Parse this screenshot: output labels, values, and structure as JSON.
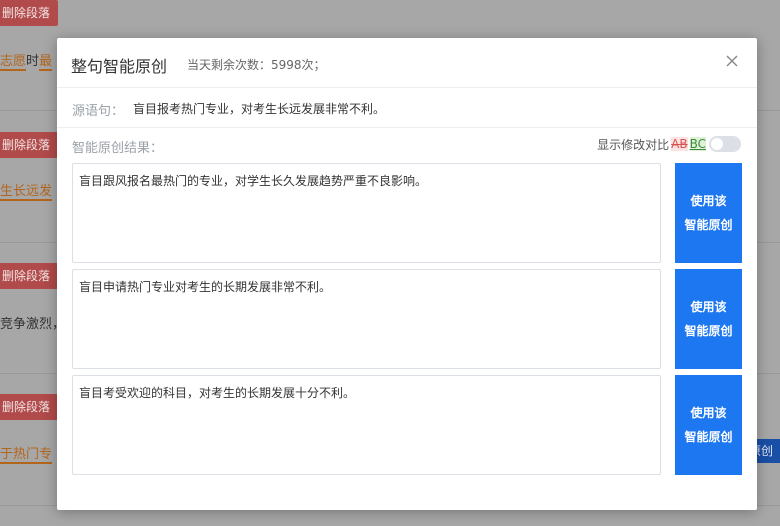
{
  "background": {
    "delete_label": "删除段落",
    "para1": {
      "hl1": "志愿",
      "mid": "时",
      "hl2": "最"
    },
    "para2": {
      "hl": "生长远发"
    },
    "para3": {
      "text": "竞争激烈，"
    },
    "para4": {
      "hl": "于热门专"
    },
    "right_button": "原创"
  },
  "modal": {
    "title": "整句智能原创",
    "remaining": "当天剩余次数：5998次；",
    "source_label": "源语句：",
    "source_text": "盲目报考热门专业，对考生长远发展非常不利。",
    "result_label": "智能原创结果：",
    "compare": {
      "label": "显示修改对比",
      "ab": "AB",
      "bc": "BC",
      "enabled": false
    },
    "results": [
      {
        "text": "盲目跟风报名最热门的专业，对学生长久发展趋势严重不良影响。",
        "button_line1": "使用该",
        "button_line2": "智能原创"
      },
      {
        "text": "盲目申请热门专业对考生的长期发展非常不利。",
        "button_line1": "使用该",
        "button_line2": "智能原创"
      },
      {
        "text": "盲目考受欢迎的科目，对考生的长期发展十分不利。",
        "button_line1": "使用该",
        "button_line2": "智能原创"
      }
    ]
  }
}
